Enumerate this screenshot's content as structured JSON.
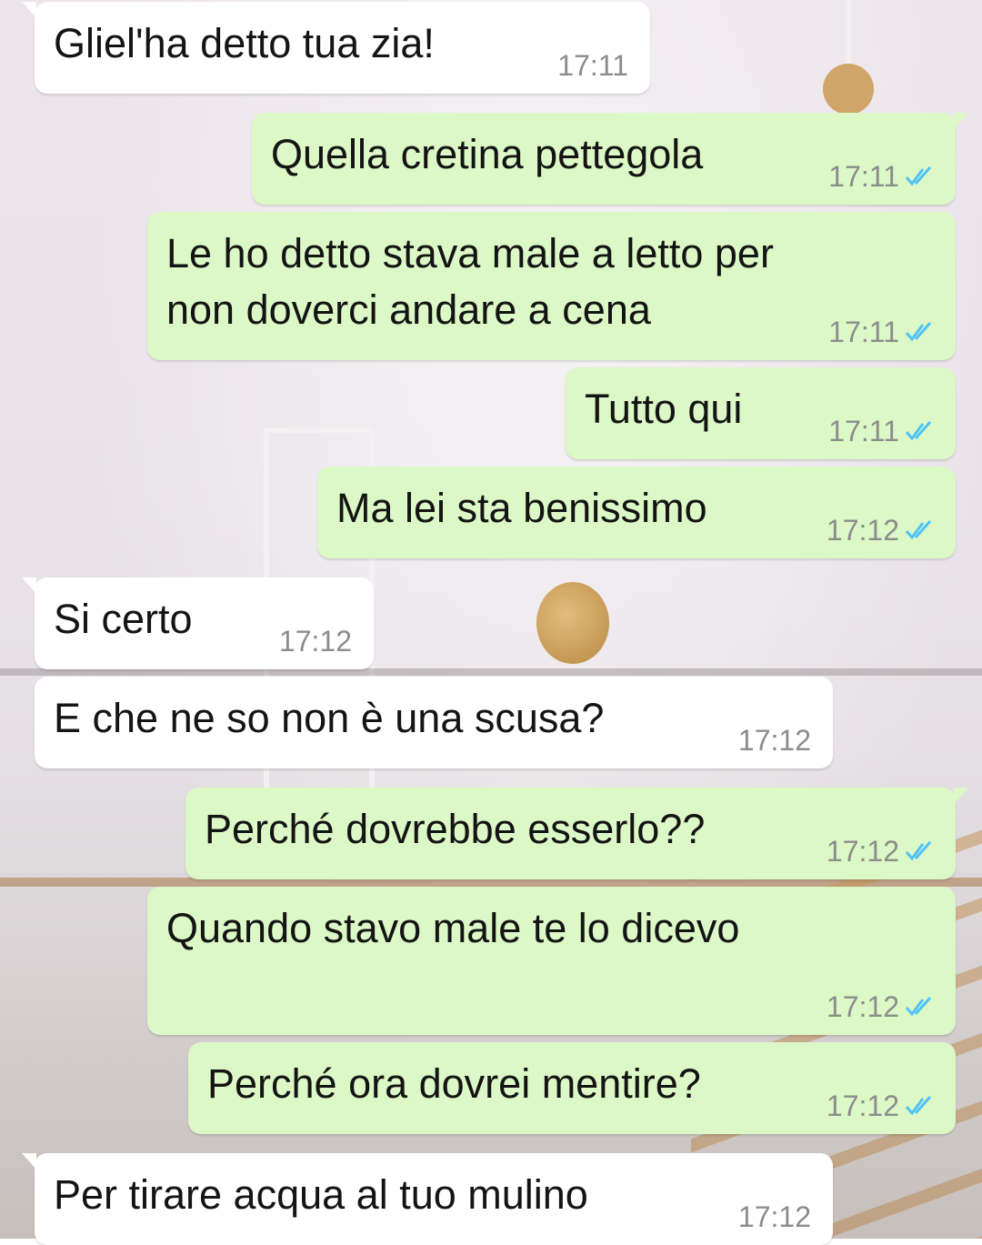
{
  "chat": {
    "messages": [
      {
        "text": "Gliel'ha detto tua zia!",
        "time": "17:11",
        "direction": "incoming",
        "status": ""
      },
      {
        "text": "Quella cretina pettegola",
        "time": "17:11",
        "direction": "outgoing",
        "status": "read-ticks-icon"
      },
      {
        "text": "Le ho detto stava male a letto per\nnon doverci andare a cena",
        "time": "17:11",
        "direction": "outgoing",
        "status": "read-ticks-icon"
      },
      {
        "text": "Tutto qui",
        "time": "17:11",
        "direction": "outgoing",
        "status": "read-ticks-icon"
      },
      {
        "text": "Ma lei sta benissimo",
        "time": "17:12",
        "direction": "outgoing",
        "status": "read-ticks-icon"
      },
      {
        "text": "Si certo",
        "time": "17:12",
        "direction": "incoming",
        "status": ""
      },
      {
        "text": "E che ne so non è una scusa?",
        "time": "17:12",
        "direction": "incoming",
        "status": ""
      },
      {
        "text": "Perché dovrebbe esserlo??",
        "time": "17:12",
        "direction": "outgoing",
        "status": "read-ticks-icon"
      },
      {
        "text": "Quando stavo male te lo dicevo",
        "time": "17:12",
        "direction": "outgoing",
        "status": "read-ticks-icon"
      },
      {
        "text": "Perché ora dovrei mentire?",
        "time": "17:12",
        "direction": "outgoing",
        "status": "read-ticks-icon"
      },
      {
        "text": "Per tirare acqua al tuo mulino",
        "time": "17:12",
        "direction": "incoming",
        "status": ""
      }
    ]
  },
  "colors": {
    "incoming_bubble": "#ffffff",
    "outgoing_bubble": "#dcf8c6",
    "read_ticks": "#4fc3f7",
    "timestamp": "#8c8c8c",
    "message_text": "#141414"
  }
}
